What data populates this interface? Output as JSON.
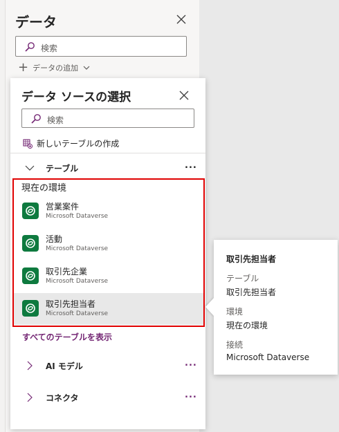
{
  "data_panel": {
    "title": "データ",
    "search_placeholder": "検索",
    "add_data_label": "データの追加"
  },
  "flyout": {
    "title": "データ ソースの選択",
    "search_placeholder": "検索",
    "new_table_label": "新しいテーブルの作成",
    "groups": {
      "tables": "テーブル",
      "ai_models": "AI モデル",
      "connectors": "コネクタ"
    },
    "more_label": "...",
    "environment_label": "現在の環境",
    "items": [
      {
        "name": "営業案件",
        "source": "Microsoft Dataverse"
      },
      {
        "name": "活動",
        "source": "Microsoft Dataverse"
      },
      {
        "name": "取引先企業",
        "source": "Microsoft Dataverse"
      },
      {
        "name": "取引先担当者",
        "source": "Microsoft Dataverse"
      }
    ],
    "show_all_label": "すべてのテーブルを表示"
  },
  "tooltip": {
    "title": "取引先担当者",
    "table_label": "テーブル",
    "table_value": "取引先担当者",
    "environment_label": "環境",
    "environment_value": "現在の環境",
    "connection_label": "接続",
    "connection_value": "Microsoft Dataverse"
  },
  "colors": {
    "accent": "#742774",
    "highlight_border": "#e00000",
    "dataverse_icon": "#0e7a3f"
  },
  "icons": [
    "close-icon",
    "search-icon",
    "plus-icon",
    "chevron-down-icon",
    "table-add-icon",
    "chevron-right-icon",
    "dataverse-icon"
  ]
}
